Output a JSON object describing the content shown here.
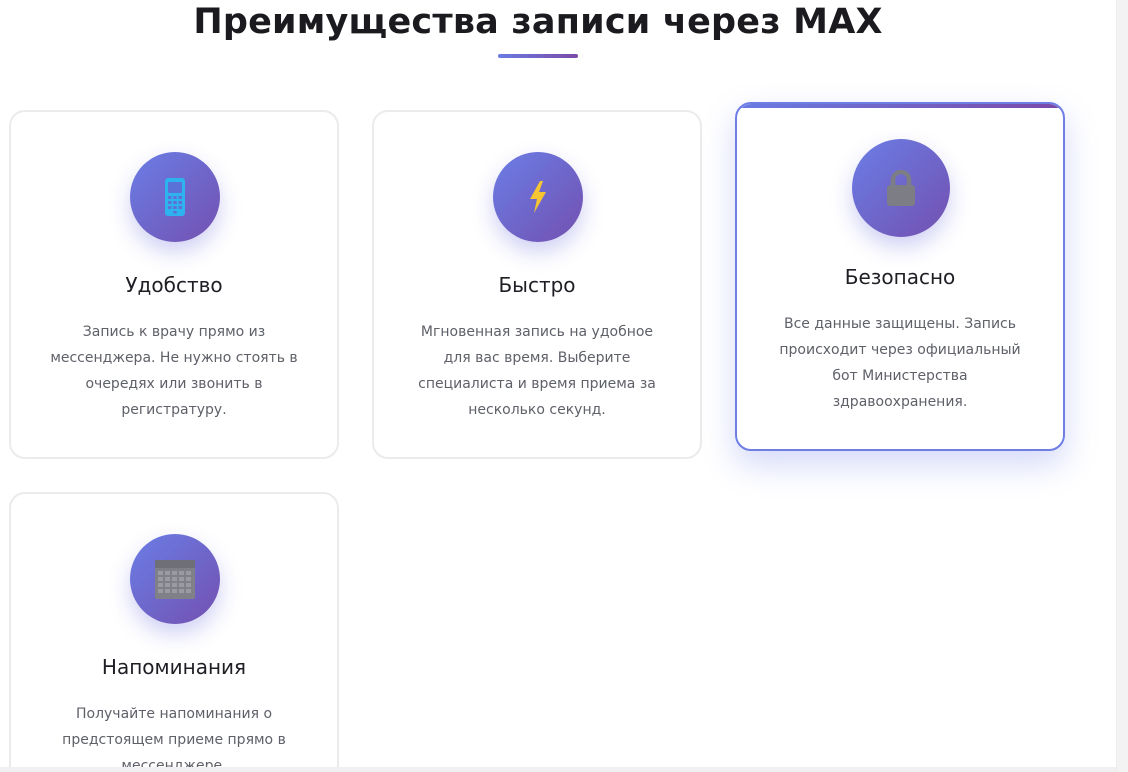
{
  "section": {
    "title": "Преимущества записи через MAX"
  },
  "colors": {
    "accent_start": "#6a7ee6",
    "accent_end": "#7350b0",
    "active_border": "#6f7ee5"
  },
  "features": [
    {
      "title": "Удобство",
      "icon": "mobile-phone-icon",
      "text": "Запись к врачу прямо из мессенджера. Не нужно стоять в очередях или звонить в регистратуру."
    },
    {
      "title": "Быстро",
      "icon": "lightning-icon",
      "text": "Мгновенная запись на удобное для вас время. Выберите специалиста и время приема за несколько секунд."
    },
    {
      "title": "Безопасно",
      "icon": "lock-icon",
      "text": "Все данные защищены. Запись происходит через официальный бот Министерства здравоохранения."
    },
    {
      "title": "Напоминания",
      "icon": "calendar-icon",
      "text": "Получайте напоминания о предстоящем приеме прямо в мессенджере."
    }
  ]
}
